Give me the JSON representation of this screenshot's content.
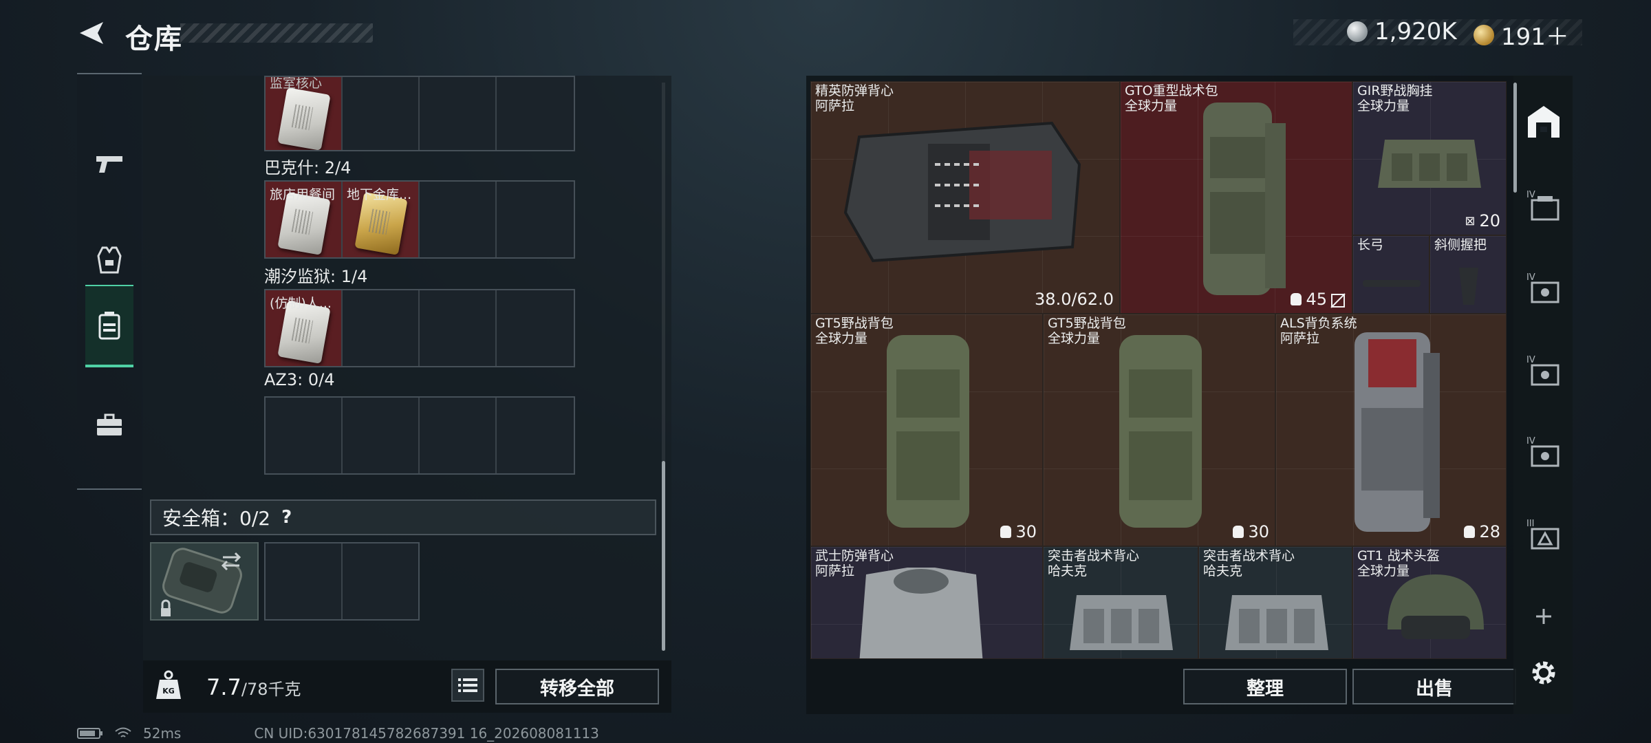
{
  "header": {
    "title": "仓库",
    "currency_silver": "1,920K",
    "currency_gold": "191＋"
  },
  "left_rail": {
    "tabs": [
      "weapons",
      "gear",
      "containers",
      "tools"
    ],
    "active": "containers"
  },
  "left_panel": {
    "top_row": {
      "label": "监室核心"
    },
    "sections": [
      {
        "label": "巴克什: 2/4",
        "items": [
          "旅店用餐间",
          "地下金库..."
        ]
      },
      {
        "label": "潮汐监狱: 1/4",
        "items": [
          "(仿制)人..."
        ]
      },
      {
        "label": "AZ3: 0/4",
        "items": []
      }
    ],
    "safe_box": {
      "label": "安全箱：0/2",
      "help": "?"
    },
    "weight": {
      "value": "7.7",
      "capacity": "/78千克",
      "progress": 0.0987
    },
    "transfer_all": "转移全部"
  },
  "right_panel": {
    "items": [
      {
        "name": "精英防弹背心",
        "faction": "阿萨拉",
        "stat": "38.0/62.0"
      },
      {
        "name": "GTO重型战术包",
        "faction": "全球力量",
        "stat": "45"
      },
      {
        "name": "GIR野战胸挂",
        "faction": "全球力量",
        "stat": "20"
      },
      {
        "name": "长弓",
        "faction": "",
        "stat": ""
      },
      {
        "name": "斜侧握把",
        "faction": "",
        "stat": ""
      },
      {
        "name": "GT5野战背包",
        "faction": "全球力量",
        "stat": "30"
      },
      {
        "name": "GT5野战背包",
        "faction": "全球力量",
        "stat": "30"
      },
      {
        "name": "ALS背负系统",
        "faction": "阿萨拉",
        "stat": "28"
      },
      {
        "name": "武士防弹背心",
        "faction": "阿萨拉",
        "stat": ""
      },
      {
        "name": "突击者战术背心",
        "faction": "哈夫克",
        "stat": ""
      },
      {
        "name": "突击者战术背心",
        "faction": "哈夫克",
        "stat": ""
      },
      {
        "name": "GT1 战术头盔",
        "faction": "全球力量",
        "stat": ""
      }
    ],
    "sort": "整理",
    "sell": "出售"
  },
  "right_rail": {
    "tier_label": "IV",
    "tier_label_3": "III"
  },
  "status": {
    "ping": "52ms",
    "uid": "CN UID:630178145782687391 16_202608081113"
  }
}
